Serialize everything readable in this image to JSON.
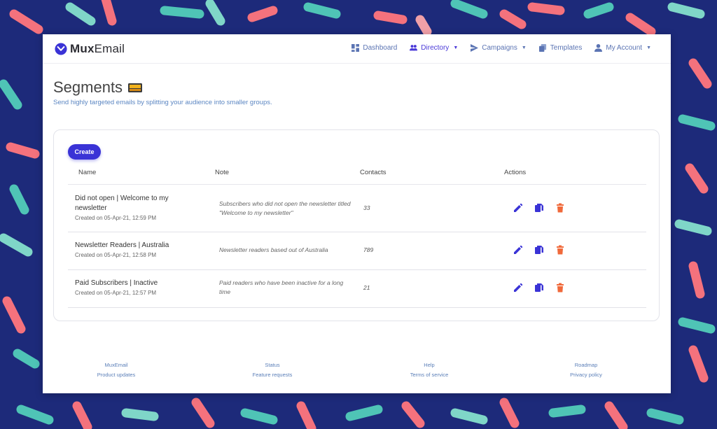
{
  "app": {
    "logo_bold": "Mux",
    "logo_light": "Email"
  },
  "nav": {
    "items": [
      {
        "label": "Dashboard",
        "icon": "dashboard-icon",
        "active": false,
        "dropdown": false
      },
      {
        "label": "Directory",
        "icon": "people-icon",
        "active": true,
        "dropdown": true
      },
      {
        "label": "Campaigns",
        "icon": "send-icon",
        "active": false,
        "dropdown": true
      },
      {
        "label": "Templates",
        "icon": "templates-icon",
        "active": false,
        "dropdown": false
      },
      {
        "label": "My Account",
        "icon": "person-icon",
        "active": false,
        "dropdown": true
      }
    ]
  },
  "page": {
    "title": "Segments",
    "subtitle": "Send highly targeted emails by splitting your audience into smaller groups."
  },
  "segments": {
    "create_label": "Create",
    "columns": [
      "Name",
      "Note",
      "Contacts",
      "Actions"
    ],
    "rows": [
      {
        "name": "Did not open | Welcome to my newsletter",
        "created": "Created on 05-Apr-21, 12:59 PM",
        "note": "Subscribers who did not open the newsletter titled \"Welcome to my newsletter\"",
        "contacts": "33"
      },
      {
        "name": "Newsletter Readers | Australia",
        "created": "Created on 05-Apr-21, 12:58 PM",
        "note": "Newsletter readers based out of Australia",
        "contacts": "789"
      },
      {
        "name": "Paid Subscribers | Inactive",
        "created": "Created on 05-Apr-21, 12:57 PM",
        "note": "Paid readers who have been inactive for a long time",
        "contacts": "21"
      }
    ]
  },
  "footer": {
    "columns": [
      [
        "MuxEmail",
        "Product updates"
      ],
      [
        "Status",
        "Feature requests"
      ],
      [
        "Help",
        "Terms of service"
      ],
      [
        "Roadmap",
        "Privacy policy"
      ]
    ]
  },
  "colors": {
    "background": "#1d2a7a",
    "accent": "#3a33d6",
    "edit_icon": "#3a33d6",
    "copy_icon": "#3a33d6",
    "delete_icon": "#f0693a"
  }
}
